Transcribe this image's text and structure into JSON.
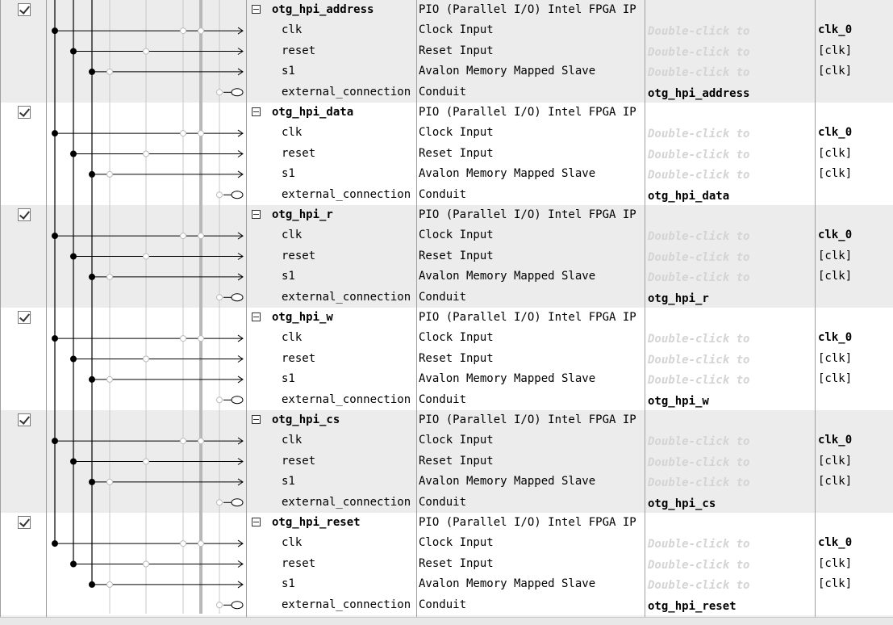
{
  "components": [
    {
      "name": "otg_hpi_address",
      "description": "PIO (Parallel I/O) Intel FPGA IP",
      "enabled": true,
      "interfaces": [
        {
          "name": "clk",
          "description": "Clock Input",
          "export_hint": "Double-click to",
          "clock": "clk_0"
        },
        {
          "name": "reset",
          "description": "Reset Input",
          "export_hint": "Double-click to",
          "clock": "[clk]"
        },
        {
          "name": "s1",
          "description": "Avalon Memory Mapped Slave",
          "export_hint": "Double-click to",
          "clock": "[clk]"
        },
        {
          "name": "external_connection",
          "description": "Conduit",
          "export": "otg_hpi_address",
          "clock": ""
        }
      ]
    },
    {
      "name": "otg_hpi_data",
      "description": "PIO (Parallel I/O) Intel FPGA IP",
      "enabled": true,
      "interfaces": [
        {
          "name": "clk",
          "description": "Clock Input",
          "export_hint": "Double-click to",
          "clock": "clk_0"
        },
        {
          "name": "reset",
          "description": "Reset Input",
          "export_hint": "Double-click to",
          "clock": "[clk]"
        },
        {
          "name": "s1",
          "description": "Avalon Memory Mapped Slave",
          "export_hint": "Double-click to",
          "clock": "[clk]"
        },
        {
          "name": "external_connection",
          "description": "Conduit",
          "export": "otg_hpi_data",
          "clock": ""
        }
      ]
    },
    {
      "name": "otg_hpi_r",
      "description": "PIO (Parallel I/O) Intel FPGA IP",
      "enabled": true,
      "interfaces": [
        {
          "name": "clk",
          "description": "Clock Input",
          "export_hint": "Double-click to",
          "clock": "clk_0"
        },
        {
          "name": "reset",
          "description": "Reset Input",
          "export_hint": "Double-click to",
          "clock": "[clk]"
        },
        {
          "name": "s1",
          "description": "Avalon Memory Mapped Slave",
          "export_hint": "Double-click to",
          "clock": "[clk]"
        },
        {
          "name": "external_connection",
          "description": "Conduit",
          "export": "otg_hpi_r",
          "clock": ""
        }
      ]
    },
    {
      "name": "otg_hpi_w",
      "description": "PIO (Parallel I/O) Intel FPGA IP",
      "enabled": true,
      "interfaces": [
        {
          "name": "clk",
          "description": "Clock Input",
          "export_hint": "Double-click to",
          "clock": "clk_0"
        },
        {
          "name": "reset",
          "description": "Reset Input",
          "export_hint": "Double-click to",
          "clock": "[clk]"
        },
        {
          "name": "s1",
          "description": "Avalon Memory Mapped Slave",
          "export_hint": "Double-click to",
          "clock": "[clk]"
        },
        {
          "name": "external_connection",
          "description": "Conduit",
          "export": "otg_hpi_w",
          "clock": ""
        }
      ]
    },
    {
      "name": "otg_hpi_cs",
      "description": "PIO (Parallel I/O) Intel FPGA IP",
      "enabled": true,
      "interfaces": [
        {
          "name": "clk",
          "description": "Clock Input",
          "export_hint": "Double-click to",
          "clock": "clk_0"
        },
        {
          "name": "reset",
          "description": "Reset Input",
          "export_hint": "Double-click to",
          "clock": "[clk]"
        },
        {
          "name": "s1",
          "description": "Avalon Memory Mapped Slave",
          "export_hint": "Double-click to",
          "clock": "[clk]"
        },
        {
          "name": "external_connection",
          "description": "Conduit",
          "export": "otg_hpi_cs",
          "clock": ""
        }
      ]
    },
    {
      "name": "otg_hpi_reset",
      "description": "PIO (Parallel I/O) Intel FPGA IP",
      "enabled": true,
      "interfaces": [
        {
          "name": "clk",
          "description": "Clock Input",
          "export_hint": "Double-click to",
          "clock": "clk_0"
        },
        {
          "name": "reset",
          "description": "Reset Input",
          "export_hint": "Double-click to",
          "clock": "[clk]"
        },
        {
          "name": "s1",
          "description": "Avalon Memory Mapped Slave",
          "export_hint": "Double-click to",
          "clock": "[clk]"
        },
        {
          "name": "external_connection",
          "description": "Conduit",
          "export": "otg_hpi_reset",
          "clock": ""
        }
      ]
    }
  ]
}
